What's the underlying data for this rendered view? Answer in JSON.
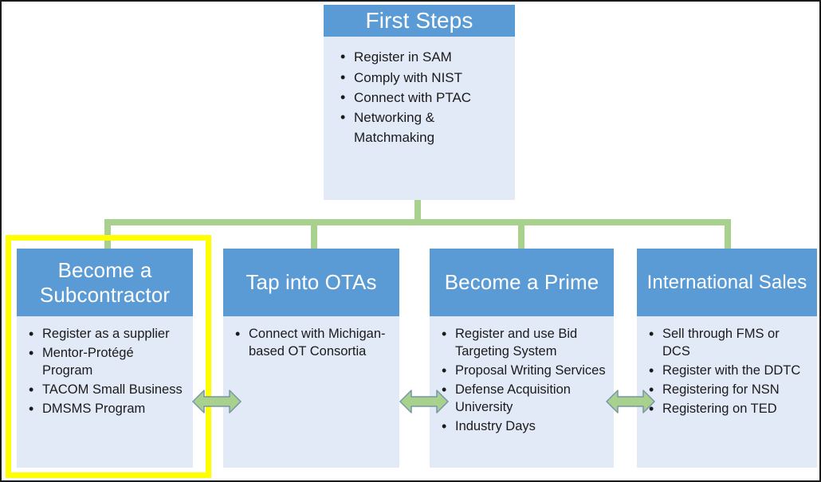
{
  "diagram": {
    "title": "First Steps pathways diagram",
    "colors": {
      "header_blue": "#5B9BD5",
      "body_blue": "#E2E9F7",
      "connector_green": "#A9D18E",
      "highlight_yellow": "#FFFF00",
      "arrow_fill": "#A9D18E",
      "arrow_stroke": "#7796A8",
      "text_dark": "#1B1B1B",
      "text_light": "#FFFFFF",
      "page_border": "#1A1A1A"
    },
    "top_node": {
      "title": "First Steps",
      "bullets": [
        "Register in SAM",
        "Comply with NIST",
        "Connect with PTAC",
        "Networking & Matchmaking"
      ]
    },
    "branches": [
      {
        "title": "Become a Subcontractor",
        "highlighted": "true",
        "bullets": [
          "Register as a supplier",
          "Mentor-Protégé Program",
          "TACOM Small Business",
          "DMSMS Program"
        ]
      },
      {
        "title": "Tap into OTAs",
        "highlighted": "false",
        "bullets": [
          "Connect with Michigan-based OT Consortia"
        ]
      },
      {
        "title": "Become a Prime",
        "highlighted": "false",
        "bullets": [
          "Register and use Bid Targeting System",
          "Proposal Writing Services",
          "Defense Acquisition University",
          "Industry Days"
        ]
      },
      {
        "title": "International Sales",
        "highlighted": "false",
        "bullets": [
          "Sell through FMS or DCS",
          "Register with the DDTC",
          "Registering for NSN",
          "Registering on TED"
        ]
      }
    ],
    "connectors": {
      "arrow_icon": "double-headed-arrow-icon",
      "count": 3
    }
  }
}
